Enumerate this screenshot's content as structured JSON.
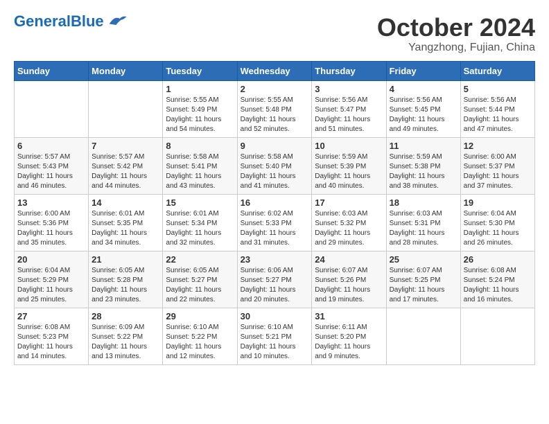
{
  "logo": {
    "general": "General",
    "blue": "Blue"
  },
  "header": {
    "month": "October 2024",
    "location": "Yangzhong, Fujian, China"
  },
  "weekdays": [
    "Sunday",
    "Monday",
    "Tuesday",
    "Wednesday",
    "Thursday",
    "Friday",
    "Saturday"
  ],
  "weeks": [
    [
      {
        "day": "",
        "info": ""
      },
      {
        "day": "",
        "info": ""
      },
      {
        "day": "1",
        "info": "Sunrise: 5:55 AM\nSunset: 5:49 PM\nDaylight: 11 hours and 54 minutes."
      },
      {
        "day": "2",
        "info": "Sunrise: 5:55 AM\nSunset: 5:48 PM\nDaylight: 11 hours and 52 minutes."
      },
      {
        "day": "3",
        "info": "Sunrise: 5:56 AM\nSunset: 5:47 PM\nDaylight: 11 hours and 51 minutes."
      },
      {
        "day": "4",
        "info": "Sunrise: 5:56 AM\nSunset: 5:45 PM\nDaylight: 11 hours and 49 minutes."
      },
      {
        "day": "5",
        "info": "Sunrise: 5:56 AM\nSunset: 5:44 PM\nDaylight: 11 hours and 47 minutes."
      }
    ],
    [
      {
        "day": "6",
        "info": "Sunrise: 5:57 AM\nSunset: 5:43 PM\nDaylight: 11 hours and 46 minutes."
      },
      {
        "day": "7",
        "info": "Sunrise: 5:57 AM\nSunset: 5:42 PM\nDaylight: 11 hours and 44 minutes."
      },
      {
        "day": "8",
        "info": "Sunrise: 5:58 AM\nSunset: 5:41 PM\nDaylight: 11 hours and 43 minutes."
      },
      {
        "day": "9",
        "info": "Sunrise: 5:58 AM\nSunset: 5:40 PM\nDaylight: 11 hours and 41 minutes."
      },
      {
        "day": "10",
        "info": "Sunrise: 5:59 AM\nSunset: 5:39 PM\nDaylight: 11 hours and 40 minutes."
      },
      {
        "day": "11",
        "info": "Sunrise: 5:59 AM\nSunset: 5:38 PM\nDaylight: 11 hours and 38 minutes."
      },
      {
        "day": "12",
        "info": "Sunrise: 6:00 AM\nSunset: 5:37 PM\nDaylight: 11 hours and 37 minutes."
      }
    ],
    [
      {
        "day": "13",
        "info": "Sunrise: 6:00 AM\nSunset: 5:36 PM\nDaylight: 11 hours and 35 minutes."
      },
      {
        "day": "14",
        "info": "Sunrise: 6:01 AM\nSunset: 5:35 PM\nDaylight: 11 hours and 34 minutes."
      },
      {
        "day": "15",
        "info": "Sunrise: 6:01 AM\nSunset: 5:34 PM\nDaylight: 11 hours and 32 minutes."
      },
      {
        "day": "16",
        "info": "Sunrise: 6:02 AM\nSunset: 5:33 PM\nDaylight: 11 hours and 31 minutes."
      },
      {
        "day": "17",
        "info": "Sunrise: 6:03 AM\nSunset: 5:32 PM\nDaylight: 11 hours and 29 minutes."
      },
      {
        "day": "18",
        "info": "Sunrise: 6:03 AM\nSunset: 5:31 PM\nDaylight: 11 hours and 28 minutes."
      },
      {
        "day": "19",
        "info": "Sunrise: 6:04 AM\nSunset: 5:30 PM\nDaylight: 11 hours and 26 minutes."
      }
    ],
    [
      {
        "day": "20",
        "info": "Sunrise: 6:04 AM\nSunset: 5:29 PM\nDaylight: 11 hours and 25 minutes."
      },
      {
        "day": "21",
        "info": "Sunrise: 6:05 AM\nSunset: 5:28 PM\nDaylight: 11 hours and 23 minutes."
      },
      {
        "day": "22",
        "info": "Sunrise: 6:05 AM\nSunset: 5:27 PM\nDaylight: 11 hours and 22 minutes."
      },
      {
        "day": "23",
        "info": "Sunrise: 6:06 AM\nSunset: 5:27 PM\nDaylight: 11 hours and 20 minutes."
      },
      {
        "day": "24",
        "info": "Sunrise: 6:07 AM\nSunset: 5:26 PM\nDaylight: 11 hours and 19 minutes."
      },
      {
        "day": "25",
        "info": "Sunrise: 6:07 AM\nSunset: 5:25 PM\nDaylight: 11 hours and 17 minutes."
      },
      {
        "day": "26",
        "info": "Sunrise: 6:08 AM\nSunset: 5:24 PM\nDaylight: 11 hours and 16 minutes."
      }
    ],
    [
      {
        "day": "27",
        "info": "Sunrise: 6:08 AM\nSunset: 5:23 PM\nDaylight: 11 hours and 14 minutes."
      },
      {
        "day": "28",
        "info": "Sunrise: 6:09 AM\nSunset: 5:22 PM\nDaylight: 11 hours and 13 minutes."
      },
      {
        "day": "29",
        "info": "Sunrise: 6:10 AM\nSunset: 5:22 PM\nDaylight: 11 hours and 12 minutes."
      },
      {
        "day": "30",
        "info": "Sunrise: 6:10 AM\nSunset: 5:21 PM\nDaylight: 11 hours and 10 minutes."
      },
      {
        "day": "31",
        "info": "Sunrise: 6:11 AM\nSunset: 5:20 PM\nDaylight: 11 hours and 9 minutes."
      },
      {
        "day": "",
        "info": ""
      },
      {
        "day": "",
        "info": ""
      }
    ]
  ]
}
